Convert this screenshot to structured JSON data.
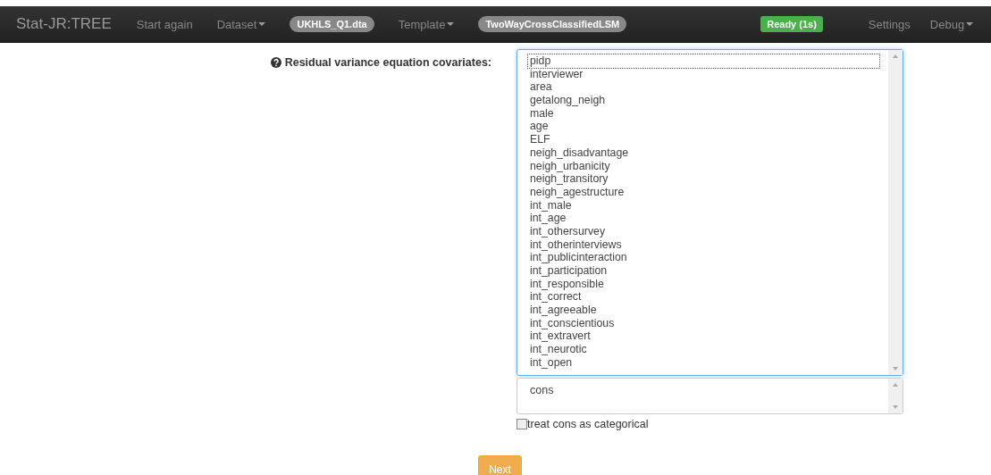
{
  "navbar": {
    "brand": "Stat-JR:TREE",
    "items": [
      {
        "kind": "link",
        "label": "Start again"
      },
      {
        "kind": "dropdown",
        "label": "Dataset"
      },
      {
        "kind": "pill",
        "label": "UKHLS_Q1.dta"
      },
      {
        "kind": "dropdown",
        "label": "Template"
      },
      {
        "kind": "pill",
        "label": "TwoWayCrossClassifiedLSM"
      }
    ],
    "status": "Ready (1s)",
    "right_items": [
      {
        "kind": "link",
        "label": "Settings"
      },
      {
        "kind": "dropdown",
        "label": "Debug"
      }
    ]
  },
  "form": {
    "label": "Residual variance equation covariates:",
    "options": [
      {
        "label": "pidp",
        "focused": true
      },
      {
        "label": "interviewer",
        "focused": false
      },
      {
        "label": "area",
        "focused": false
      },
      {
        "label": "getalong_neigh",
        "focused": false
      },
      {
        "label": "male",
        "focused": false
      },
      {
        "label": "age",
        "focused": false
      },
      {
        "label": "ELF",
        "focused": false
      },
      {
        "label": "neigh_disadvantage",
        "focused": false
      },
      {
        "label": "neigh_urbanicity",
        "focused": false
      },
      {
        "label": "neigh_transitory",
        "focused": false
      },
      {
        "label": "neigh_agestructure",
        "focused": false
      },
      {
        "label": "int_male",
        "focused": false
      },
      {
        "label": "int_age",
        "focused": false
      },
      {
        "label": "int_othersurvey",
        "focused": false
      },
      {
        "label": "int_otherinterviews",
        "focused": false
      },
      {
        "label": "int_publicinteraction",
        "focused": false
      },
      {
        "label": "int_participation",
        "focused": false
      },
      {
        "label": "int_responsible",
        "focused": false
      },
      {
        "label": "int_correct",
        "focused": false
      },
      {
        "label": "int_agreeable",
        "focused": false
      },
      {
        "label": "int_conscientious",
        "focused": false
      },
      {
        "label": "int_extravert",
        "focused": false
      },
      {
        "label": "int_neurotic",
        "focused": false
      },
      {
        "label": "int_open",
        "focused": false
      }
    ],
    "second_options": [
      {
        "label": "cons"
      }
    ],
    "checkbox": {
      "label": "treat cons as categorical",
      "checked": false
    },
    "button": "Next"
  }
}
